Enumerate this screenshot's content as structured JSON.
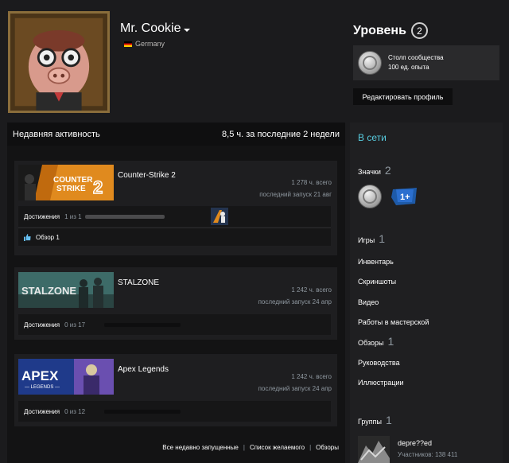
{
  "profile": {
    "name": "Mr. Cookie",
    "country": "Germany"
  },
  "level": {
    "title": "Уровень",
    "value": "2"
  },
  "badge": {
    "name": "Столп сообщества",
    "xp": "100 ед. опыта"
  },
  "edit_profile_label": "Редактировать профиль",
  "activity": {
    "title": "Недавняя активность",
    "summary": "8,5 ч. за последние 2 недели"
  },
  "games": [
    {
      "name": "Counter-Strike 2",
      "total": "1 278 ч. всего",
      "last_played": "последний запуск 21 авг",
      "ach_label": "Достижения",
      "ach_count": "1 из 1",
      "ach_progress": 1,
      "review_label": "Обзор 1"
    },
    {
      "name": "STALZONE",
      "total": "1 242 ч. всего",
      "last_played": "последний запуск 24 апр",
      "ach_label": "Достижения",
      "ach_count": "0 из 17",
      "ach_progress": 0
    },
    {
      "name": "Apex Legends",
      "total": "1 242 ч. всего",
      "last_played": "последний запуск 24 апр",
      "ach_label": "Достижения",
      "ach_count": "0 из 12",
      "ach_progress": 0
    }
  ],
  "footer": {
    "recent": "Все недавно запущенные",
    "wishlist": "Список желаемого",
    "reviews": "Обзоры"
  },
  "side": {
    "status": "В сети",
    "badges_label": "Значки",
    "badges_count": "2",
    "games_label": "Игры",
    "games_count": "1",
    "inventory": "Инвентарь",
    "screenshots": "Скриншоты",
    "videos": "Видео",
    "workshop": "Работы в мастерской",
    "reviews_label": "Обзоры",
    "reviews_count": "1",
    "guides": "Руководства",
    "artwork": "Иллюстрации",
    "groups_label": "Группы",
    "groups_count": "1",
    "group_name": "depre??ed",
    "group_members": "Участников: 138 411",
    "years_badge_text": "1+"
  },
  "capsules": {
    "cs2_line1": "COUNTER",
    "cs2_line2": "STRIKE",
    "cs2_num": "2",
    "stalzone": "STALZONE",
    "apex": "APEX",
    "apex_sub": "— LEGENDS —"
  },
  "colors": {
    "accent_online": "#57cbde",
    "cs2_orange": "#e08a1e",
    "stalzone_teal": "#3d6b68",
    "apex_blue": "#1f3a8a"
  },
  "icons": {
    "cs2_achievement": "cs2-achievement-icon",
    "review": "thumbs-up-icon",
    "community_badge": "community-pillar-badge-icon",
    "years_badge": "years-of-service-badge-icon"
  }
}
